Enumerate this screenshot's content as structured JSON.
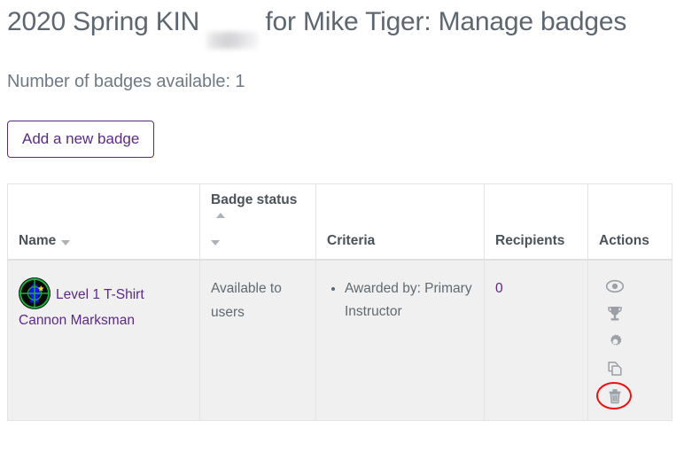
{
  "header": {
    "title_prefix": "2020 Spring KIN ",
    "title_redacted": "[redacted]",
    "title_suffix": " for Mike Tiger: Manage badges",
    "badges_available": "Number of badges available: 1"
  },
  "toolbar": {
    "add_badge_label": "Add a new badge"
  },
  "table": {
    "columns": [
      {
        "key": "name",
        "label": "Name",
        "sort_icon": "chevron-down-icon"
      },
      {
        "key": "status",
        "label": "Badge status",
        "sort_icon_up": "chevron-up-icon",
        "sort_icon_down": "chevron-down-icon"
      },
      {
        "key": "criteria",
        "label": "Criteria"
      },
      {
        "key": "recipients",
        "label": "Recipients"
      },
      {
        "key": "actions",
        "label": "Actions"
      }
    ],
    "rows": [
      {
        "badge_image_alt": "marksman-badge-image",
        "name": "Level 1 T-Shirt Cannon Marksman",
        "status": "Available to users",
        "criteria": [
          "Awarded by: Primary Instructor"
        ],
        "recipients": "0",
        "actions": [
          {
            "name": "preview-badge-icon",
            "label": "Preview"
          },
          {
            "name": "award-badge-icon",
            "label": "Award badge"
          },
          {
            "name": "settings-badge-icon",
            "label": "Edit settings"
          },
          {
            "name": "duplicate-badge-icon",
            "label": "Duplicate"
          },
          {
            "name": "delete-badge-icon",
            "label": "Delete",
            "highlighted": true
          }
        ]
      }
    ]
  },
  "colors": {
    "link": "#5b2a86",
    "title_text": "#5d6771",
    "header_text": "#4a525a",
    "body_text": "#5f6a72",
    "row_background": "#f0f0f0",
    "border": "#e3e4e6",
    "icon": "#9aa0a6",
    "highlight": "#ee1111"
  }
}
